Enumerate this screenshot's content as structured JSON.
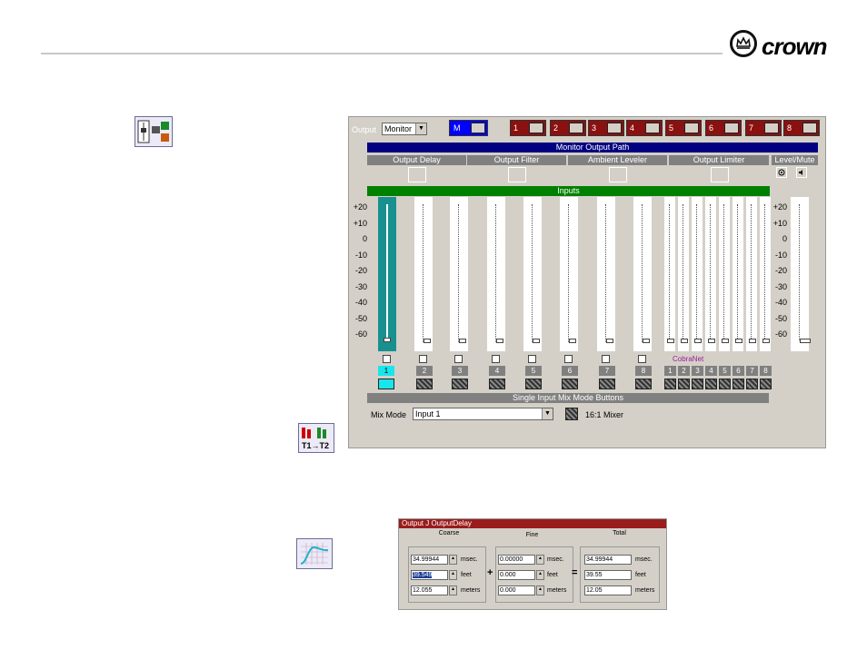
{
  "brand": {
    "name": "crown"
  },
  "window": {
    "output_label": "Output",
    "output_select": "Monitor",
    "monitor_button": "M",
    "channels": [
      "1",
      "2",
      "3",
      "4",
      "5",
      "6",
      "7",
      "8"
    ],
    "path_title": "Monitor Output Path",
    "sections": [
      "Output Delay",
      "Output Filter",
      "Ambient Leveler",
      "Output Limiter",
      "Level/Mute"
    ],
    "inputs_bar": "Inputs",
    "db_scale": [
      "+20",
      "+10",
      "0",
      "-10",
      "-20",
      "-30",
      "-40",
      "-50",
      "-60"
    ],
    "input_numbers": [
      "1",
      "2",
      "3",
      "4",
      "5",
      "6",
      "7",
      "8"
    ],
    "cobranet_label": "CobraNet",
    "cobranet_numbers": [
      "1",
      "2",
      "3",
      "4",
      "5",
      "6",
      "7",
      "8"
    ],
    "mix_bar": "Single Input Mix Mode Buttons",
    "mix_mode_label": "Mix Mode",
    "mix_mode_value": "Input 1",
    "mixer_label": "16:1 Mixer",
    "colors": {
      "navy": "#000080",
      "green": "#008000",
      "dark_red": "#8b1010",
      "cyan": "#19e6ec",
      "blue": "#0000ff"
    }
  },
  "delay": {
    "title": "Output J OutputDelay",
    "groups": {
      "coarse": "Coarse",
      "fine": "Fine",
      "total": "Total"
    },
    "coarse": {
      "msec": "34.99944",
      "feet": "39.549",
      "meters": "12.055"
    },
    "fine": {
      "msec": "0.00000",
      "feet": "0.000",
      "meters": "0.000"
    },
    "total": {
      "msec": "34.99944",
      "feet": "39.55",
      "meters": "12.05"
    },
    "units": {
      "msec": "msec.",
      "feet": "feet",
      "meters": "meters"
    },
    "plus": "+",
    "equals": "="
  }
}
